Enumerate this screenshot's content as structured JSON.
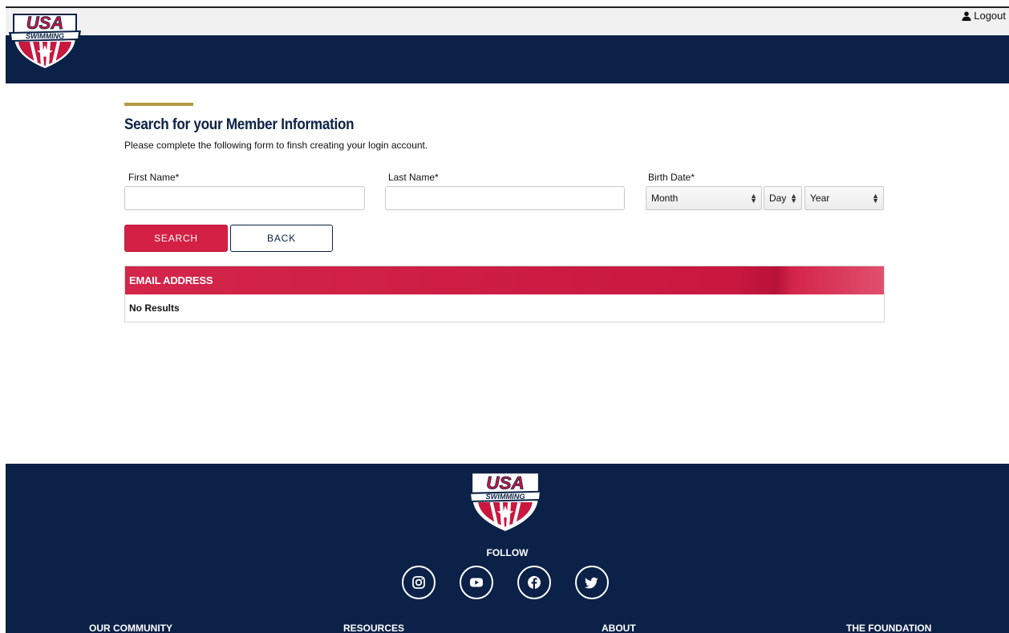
{
  "header": {
    "logo_text_top": "USA",
    "logo_text_banner": "SWIMMING",
    "logout_label": "Logout",
    "icon": "user-icon"
  },
  "main": {
    "title": "Search for your Member Information",
    "subtitle": "Please complete the following form to finsh creating your login account.",
    "first_name_label": "First Name*",
    "first_name_value": "",
    "last_name_label": "Last Name*",
    "last_name_value": "",
    "birth_date_label": "Birth Date*",
    "month_select": "Month",
    "day_select": "Day",
    "year_select": "Year",
    "search_button": "SEARCH",
    "back_button": "BACK"
  },
  "results": {
    "column_header": "EMAIL ADDRESS",
    "empty_text": "No Results"
  },
  "footer": {
    "logo_text_top": "USA",
    "logo_text_banner": "SWIMMING",
    "follow_label": "FOLLOW",
    "social_icons": [
      "instagram-icon",
      "youtube-icon",
      "facebook-icon",
      "twitter-icon"
    ],
    "links": [
      "OUR COMMUNITY",
      "RESOURCES",
      "ABOUT",
      "THE FOUNDATION"
    ]
  },
  "colors": {
    "navy": "#0b2147",
    "red": "#d32044",
    "gold": "#b59a3f",
    "topbar": "#f1f1f1"
  }
}
